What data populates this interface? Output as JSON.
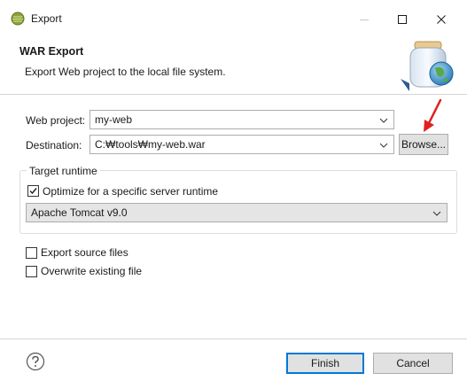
{
  "window": {
    "title": "Export"
  },
  "header": {
    "title": "WAR Export",
    "description": "Export Web project to the local file system."
  },
  "form": {
    "web_project_label": "Web project:",
    "web_project_value": "my-web",
    "destination_label": "Destination:",
    "destination_value": "C:₩tools₩my-web.war",
    "browse_label": "Browse..."
  },
  "target_runtime": {
    "group_label": "Target runtime",
    "optimize_label": "Optimize for a specific server runtime",
    "optimize_checked": true,
    "runtime_value": "Apache Tomcat v9.0"
  },
  "options": {
    "export_source_label": "Export source files",
    "export_source_checked": false,
    "overwrite_label": "Overwrite existing file",
    "overwrite_checked": false
  },
  "footer": {
    "finish_label": "Finish",
    "cancel_label": "Cancel"
  },
  "colors": {
    "accent": "#0078d7",
    "annotation_arrow": "#e02020"
  }
}
